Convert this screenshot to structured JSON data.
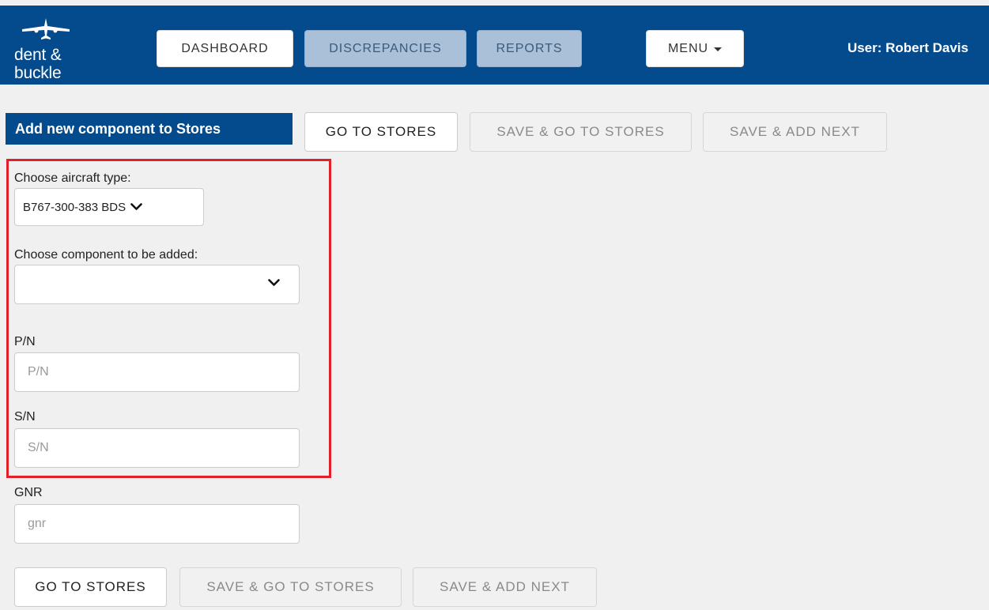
{
  "brand": {
    "line1": "dent &",
    "line2": "buckle"
  },
  "nav": {
    "dashboard": "DASHBOARD",
    "discrepancies": "DISCREPANCIES",
    "reports": "REPORTS",
    "menu": "MENU"
  },
  "user": {
    "label": "User: Robert Davis"
  },
  "page": {
    "title": "Add new component to Stores"
  },
  "top_actions": {
    "go_to_stores": "GO TO STORES",
    "save_go_to_stores": "SAVE & GO TO STORES",
    "save_add_next": "SAVE & ADD NEXT"
  },
  "form": {
    "aircraft_label": "Choose aircraft type:",
    "aircraft_value": "B767-300-383 BDS",
    "component_label": "Choose component to be added:",
    "component_value": "",
    "pn_label": "P/N",
    "pn_placeholder": "P/N",
    "sn_label": "S/N",
    "sn_placeholder": "S/N",
    "gnr_label": "GNR",
    "gnr_placeholder": "gnr"
  },
  "bottom_actions": {
    "go_to_stores": "GO TO STORES",
    "save_go_to_stores": "SAVE & GO TO STORES",
    "save_add_next": "SAVE & ADD NEXT"
  },
  "colors": {
    "header_bg": "#034b8c",
    "highlight_border": "#e0202a",
    "page_bg": "#f0f0f0"
  }
}
